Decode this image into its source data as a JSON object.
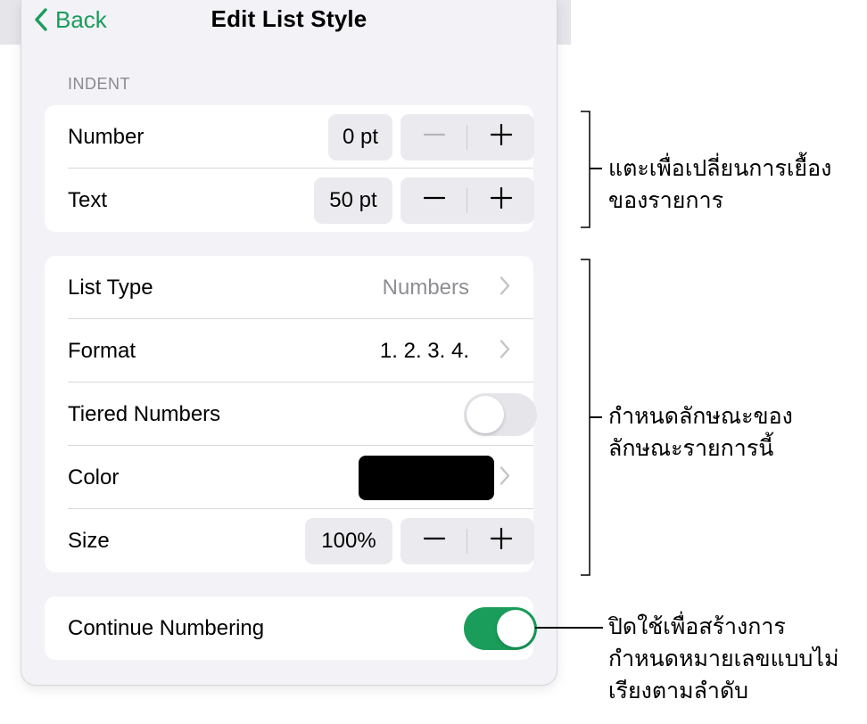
{
  "nav": {
    "back_label": "Back",
    "title": "Edit List Style"
  },
  "indent": {
    "section_label": "INDENT",
    "number": {
      "label": "Number",
      "value": "0 pt"
    },
    "text": {
      "label": "Text",
      "value": "50 pt"
    }
  },
  "style": {
    "list_type": {
      "label": "List Type",
      "value": "Numbers"
    },
    "format": {
      "label": "Format",
      "value": "1. 2. 3. 4."
    },
    "tiered": {
      "label": "Tiered Numbers",
      "on": false
    },
    "color": {
      "label": "Color",
      "swatch": "#000000"
    },
    "size": {
      "label": "Size",
      "value": "100%"
    }
  },
  "continue": {
    "label": "Continue Numbering",
    "on": true
  },
  "callouts": {
    "indent": [
      "แตะเพื่อเปลี่ยนการเยื้อง",
      "ของรายการ"
    ],
    "style": [
      "กำหนดลักษณะของ",
      "ลักษณะรายการนี้"
    ],
    "continue": [
      "ปิดใช้เพื่อสร้างการ",
      "กำหนดหมายเลขแบบไม่",
      "เรียงตามลำดับ"
    ]
  },
  "colors": {
    "accent": "#1a9d5a",
    "panel": "#f2f2f7",
    "card": "#ffffff"
  }
}
